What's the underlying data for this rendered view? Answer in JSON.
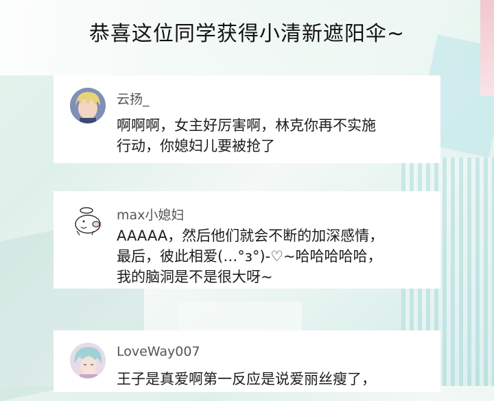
{
  "page_title": "恭喜这位同学获得小清新遮阳伞~",
  "comments": [
    {
      "username": "云扬_",
      "lines": [
        "啊啊啊，女主好厉害啊，林克你再不实施",
        "行动，你媳妇儿要被抢了"
      ]
    },
    {
      "username": "max小媳妇",
      "lines": [
        "AAAAA，然后他们就会不断的加深感情，",
        "最后，彼此相爱(…°з°)-♡~哈哈哈哈哈，",
        "我的脑洞是不是很大呀~"
      ]
    },
    {
      "username": "LoveWay007",
      "lines": [
        "王子是真爱啊第一反应是说爱丽丝瘦了，"
      ]
    }
  ]
}
